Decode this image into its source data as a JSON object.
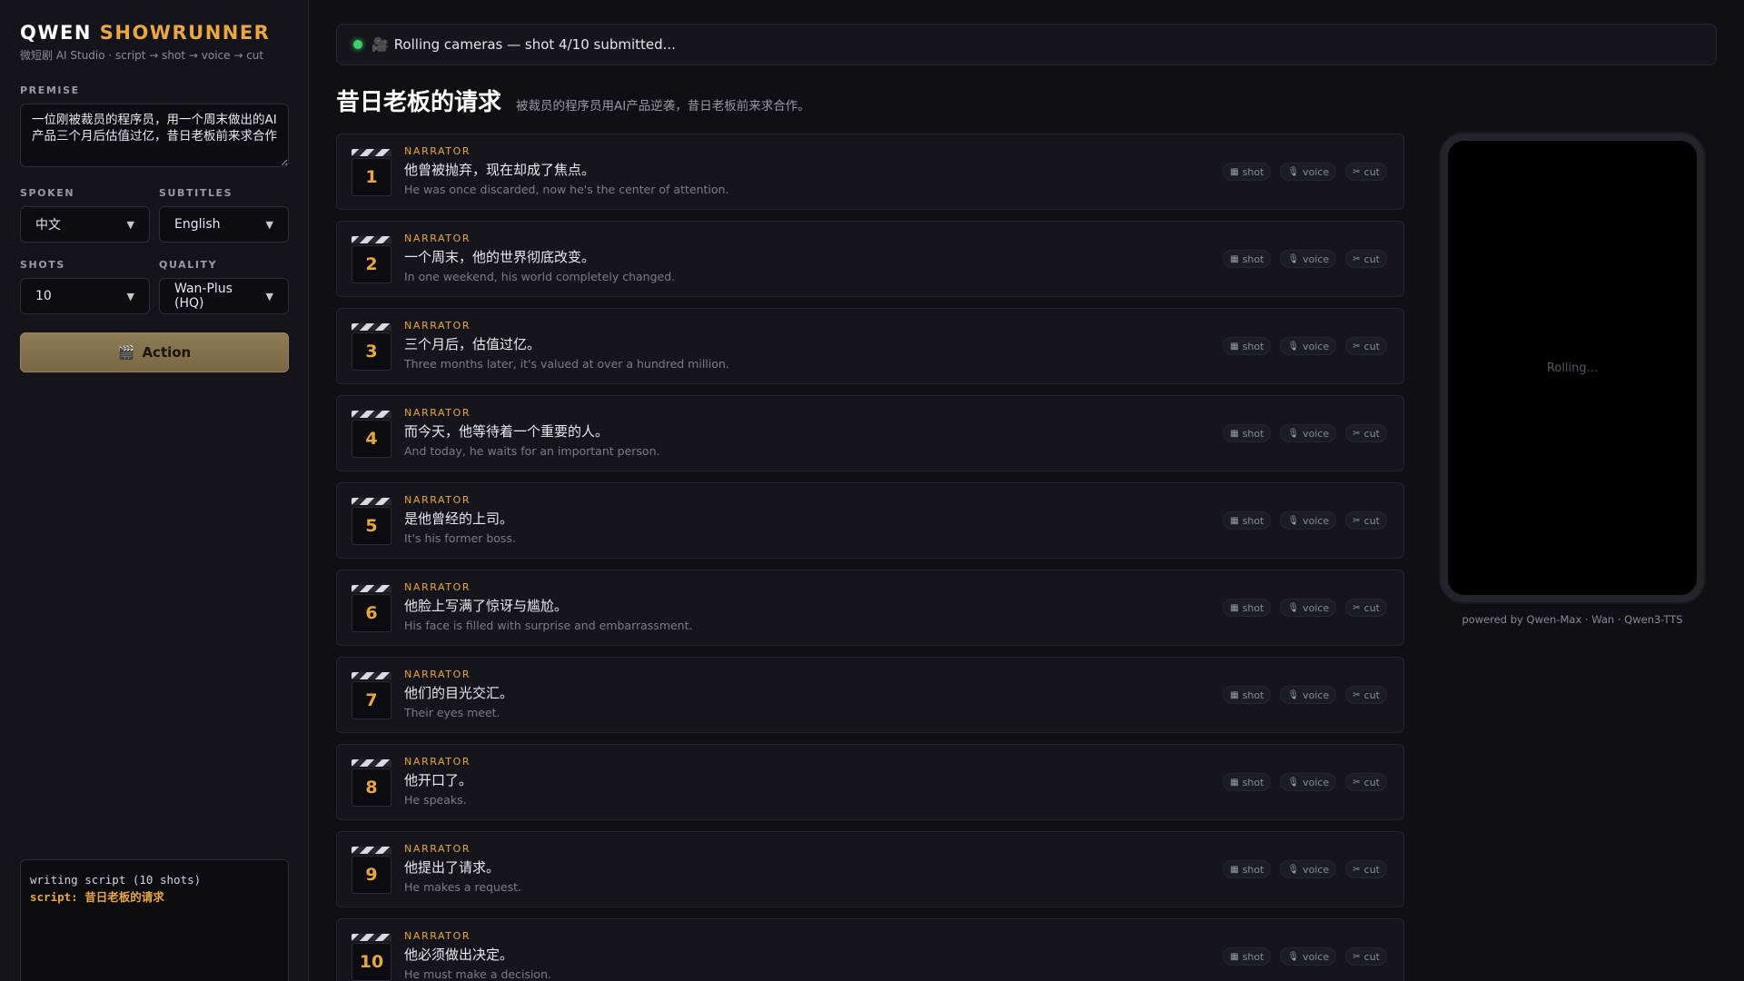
{
  "app": {
    "brand_left": "QWEN",
    "brand_right": "SHOWRUNNER",
    "tagline": "微短剧 AI Studio · script → shot → voice → cut"
  },
  "sidebar": {
    "premise_label": "PREMISE",
    "premise_value": "一位刚被裁员的程序员，用一个周末做出的AI产品三个月后估值过亿，昔日老板前来求合作",
    "spoken_label": "SPOKEN",
    "spoken_value": "中文",
    "subtitles_label": "SUBTITLES",
    "subtitles_value": "English",
    "shots_label": "SHOTS",
    "shots_value": "10",
    "quality_label": "QUALITY",
    "quality_value": "Wan-Plus (HQ)",
    "action_label": "Action",
    "log_lines": [
      "writing script (10 shots)",
      "script: 昔日老板的请求"
    ]
  },
  "status": {
    "text": "Rolling cameras — shot 4/10 submitted...",
    "dot_color": "#3ecf6a"
  },
  "script": {
    "title": "昔日老板的请求",
    "logline": "被裁员的程序员用AI产品逆袭，昔日老板前来求合作。"
  },
  "chips": {
    "shot": "shot",
    "voice": "voice",
    "cut": "cut"
  },
  "shots": [
    {
      "num": "1",
      "speaker": "NARRATOR",
      "zh": "他曾被抛弃，现在却成了焦点。",
      "en": "He was once discarded, now he's the center of attention."
    },
    {
      "num": "2",
      "speaker": "NARRATOR",
      "zh": "一个周末，他的世界彻底改变。",
      "en": "In one weekend, his world completely changed."
    },
    {
      "num": "3",
      "speaker": "NARRATOR",
      "zh": "三个月后，估值过亿。",
      "en": "Three months later, it's valued at over a hundred million."
    },
    {
      "num": "4",
      "speaker": "NARRATOR",
      "zh": "而今天，他等待着一个重要的人。",
      "en": "And today, he waits for an important person."
    },
    {
      "num": "5",
      "speaker": "NARRATOR",
      "zh": "是他曾经的上司。",
      "en": "It's his former boss."
    },
    {
      "num": "6",
      "speaker": "NARRATOR",
      "zh": "他脸上写满了惊讶与尴尬。",
      "en": "His face is filled with surprise and embarrassment."
    },
    {
      "num": "7",
      "speaker": "NARRATOR",
      "zh": "他们的目光交汇。",
      "en": "Their eyes meet."
    },
    {
      "num": "8",
      "speaker": "NARRATOR",
      "zh": "他开口了。",
      "en": "He speaks."
    },
    {
      "num": "9",
      "speaker": "NARRATOR",
      "zh": "他提出了请求。",
      "en": "He makes a request."
    },
    {
      "num": "10",
      "speaker": "NARRATOR",
      "zh": "他必须做出决定。",
      "en": "He must make a decision."
    }
  ],
  "preview": {
    "rolling_text": "Rolling...",
    "powered_by": "powered by Qwen-Max · Wan · Qwen3-TTS"
  },
  "colors": {
    "accent": "#e8a745",
    "background": "#0f0f14"
  }
}
